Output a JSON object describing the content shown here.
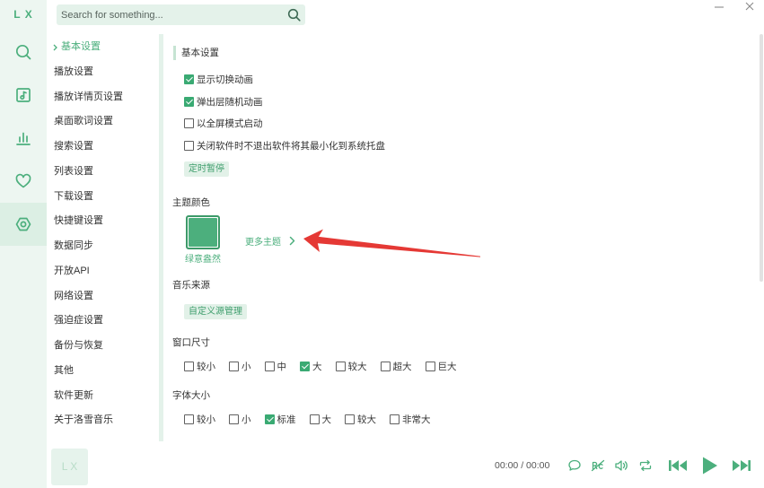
{
  "app": {
    "logo": "L X"
  },
  "colors": {
    "accent": "#4caf7d",
    "accent_dark": "#3d9a69",
    "accent_light": "#e2f1e8",
    "sidebar_bg": "#edf6f1",
    "sidebar_active_bg": "#dcefe4",
    "annotation_arrow": "#e53935"
  },
  "search": {
    "placeholder": "Search for something...",
    "icon": "search-icon"
  },
  "window_controls": [
    {
      "icon": "minimize-icon"
    },
    {
      "icon": "close-icon"
    }
  ],
  "sidebar": {
    "items": [
      {
        "icon": "search-icon",
        "active": false
      },
      {
        "icon": "song-list-icon",
        "active": false
      },
      {
        "icon": "leaderboard-icon",
        "active": false
      },
      {
        "icon": "favorite-icon",
        "active": false
      },
      {
        "icon": "settings-icon",
        "active": true
      }
    ]
  },
  "settings_nav": {
    "items": [
      "基本设置",
      "播放设置",
      "播放详情页设置",
      "桌面歌词设置",
      "搜索设置",
      "列表设置",
      "下载设置",
      "快捷键设置",
      "数据同步",
      "开放API",
      "网络设置",
      "强迫症设置",
      "备份与恢复",
      "其他",
      "软件更新",
      "关于洛雪音乐"
    ],
    "active_index": 0
  },
  "basic": {
    "title": "基本设置",
    "options": [
      {
        "label": "显示切换动画",
        "checked": true
      },
      {
        "label": "弹出层随机动画",
        "checked": true
      },
      {
        "label": "以全屏模式启动",
        "checked": false
      },
      {
        "label": "关闭软件时不退出软件将其最小化到系统托盘",
        "checked": false
      }
    ],
    "timer_button": "定时暂停"
  },
  "theme": {
    "title": "主题颜色",
    "current": {
      "name": "绿意盎然",
      "color": "#4caf7d"
    },
    "more_label": "更多主题"
  },
  "music_source": {
    "title": "音乐来源",
    "button": "自定义源管理"
  },
  "window_size": {
    "title": "窗口尺寸",
    "options": [
      {
        "label": "较小",
        "checked": false
      },
      {
        "label": "小",
        "checked": false
      },
      {
        "label": "中",
        "checked": false
      },
      {
        "label": "大",
        "checked": true
      },
      {
        "label": "较大",
        "checked": false
      },
      {
        "label": "超大",
        "checked": false
      },
      {
        "label": "巨大",
        "checked": false
      }
    ]
  },
  "font_size": {
    "title": "字体大小",
    "options": [
      {
        "label": "较小",
        "checked": false
      },
      {
        "label": "小",
        "checked": false
      },
      {
        "label": "标准",
        "checked": true
      },
      {
        "label": "大",
        "checked": false
      },
      {
        "label": "较大",
        "checked": false
      },
      {
        "label": "非常大",
        "checked": false
      }
    ]
  },
  "player": {
    "logo": "L X",
    "time": "00:00 / 00:00",
    "controls": [
      "comment-icon",
      "desktop-lyric-icon",
      "volume-icon",
      "repeat-icon",
      "previous-icon",
      "play-icon",
      "next-icon"
    ]
  }
}
